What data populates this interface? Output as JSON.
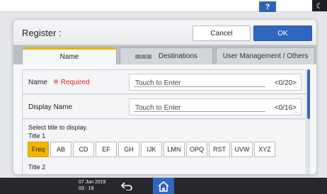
{
  "topbar": {
    "help_label": "?",
    "moon_icon": "moon-icon"
  },
  "dialog": {
    "title": "Register :",
    "cancel_label": "Cancel",
    "ok_label": "OK",
    "tabs": [
      {
        "label": "Name",
        "active": true
      },
      {
        "label": "Destinations",
        "icon": "destination-icons",
        "active": false
      },
      {
        "label": "User Management / Others",
        "active": false
      }
    ]
  },
  "form": {
    "name": {
      "label": "Name",
      "required_text": "※ Required",
      "placeholder": "Touch to Enter",
      "counter": "<0/20>"
    },
    "display_name": {
      "label": "Display Name",
      "placeholder": "Touch to Enter",
      "counter": "<0/16>"
    },
    "select_title_text": "Select title to display.",
    "title1_label": "Title 1",
    "title2_label": "Title 2",
    "title_keys": [
      {
        "label": "Freq",
        "active": true
      },
      {
        "label": "AB"
      },
      {
        "label": "CD"
      },
      {
        "label": "EF"
      },
      {
        "label": "GH"
      },
      {
        "label": "IJK"
      },
      {
        "label": "LMN"
      },
      {
        "label": "OPQ"
      },
      {
        "label": "RST"
      },
      {
        "label": "UVW"
      },
      {
        "label": "XYZ"
      }
    ]
  },
  "footer": {
    "date": "07 Jun 2019",
    "time": "03 : 19",
    "back_icon": "back-arrow-icon",
    "home_icon": "home-icon"
  },
  "colors": {
    "accent_blue": "#2e66c0",
    "tab_highlight": "#e8b100",
    "required_red": "#d7262c",
    "active_key": "#f2b600"
  }
}
